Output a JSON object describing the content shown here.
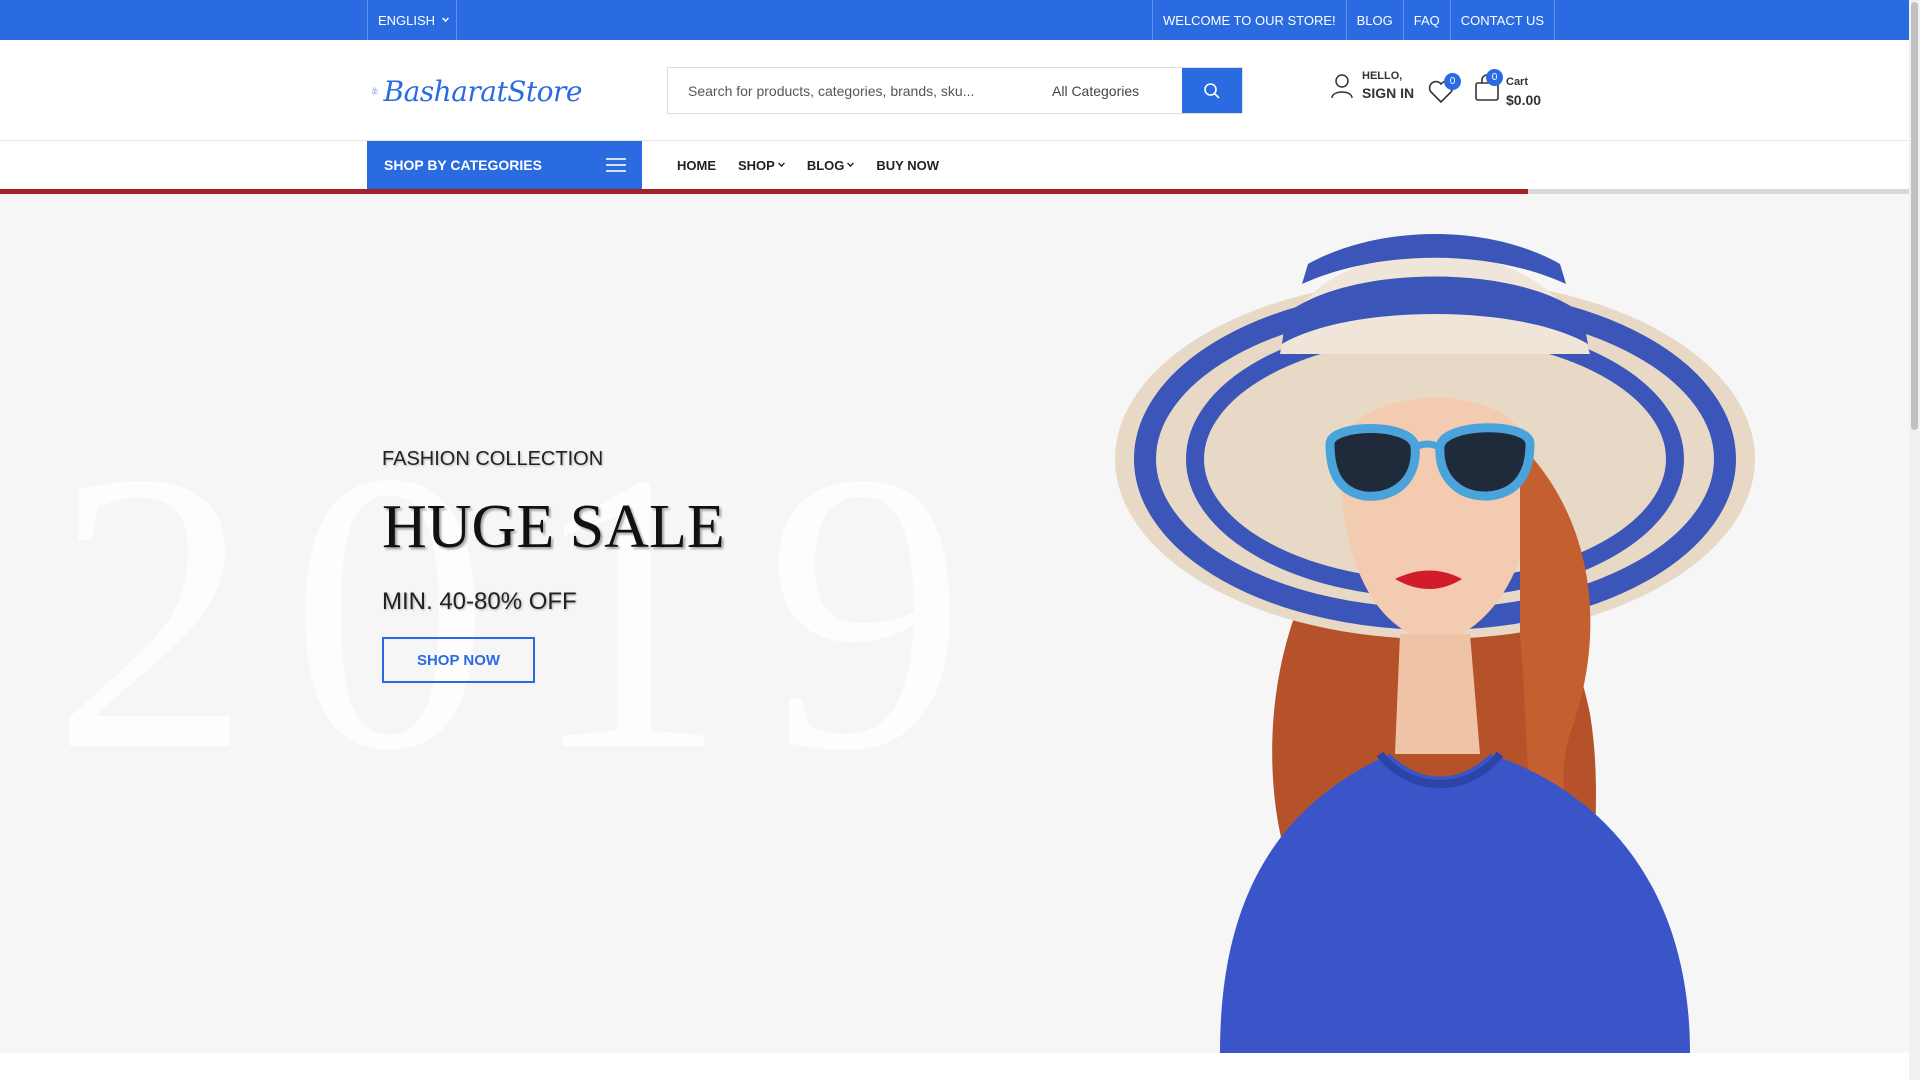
{
  "topbar": {
    "language": "ENGLISH",
    "welcome": "WELCOME TO OUR STORE!",
    "links": [
      "BLOG",
      "FAQ",
      "CONTACT US"
    ]
  },
  "header": {
    "logo_text": "BasharatStore",
    "search": {
      "placeholder": "Search for products, categories, brands, sku...",
      "category": "All Categories"
    },
    "account": {
      "greeting": "HELLO,",
      "action": "SIGN IN"
    },
    "wishlist_count": "0",
    "cart": {
      "count": "0",
      "label": "Cart",
      "total": "$0.00"
    }
  },
  "nav": {
    "categories_label": "SHOP BY CATEGORIES",
    "items": [
      "HOME",
      "SHOP",
      "BLOG",
      "BUY NOW"
    ]
  },
  "hero": {
    "background_year": "2019",
    "subtitle": "FASHION COLLECTION",
    "headline": "HUGE SALE",
    "offer": "MIN. 40-80% OFF",
    "cta": "SHOP NOW"
  },
  "colors": {
    "brand": "#2a6be2",
    "accent_line": "#a32227",
    "hero_bg": "#f6f6f6"
  }
}
